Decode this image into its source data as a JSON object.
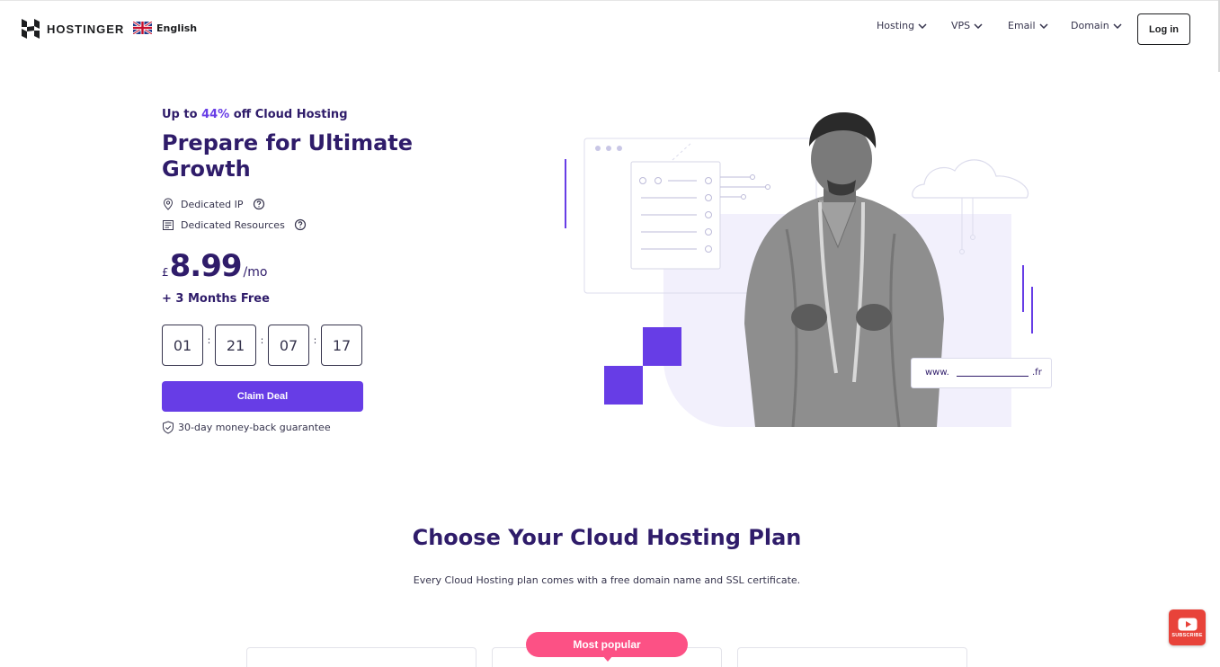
{
  "header": {
    "brand": "HOSTINGER",
    "language": "English",
    "nav": [
      {
        "label": "Hosting"
      },
      {
        "label": "VPS"
      },
      {
        "label": "Email"
      },
      {
        "label": "Domain"
      }
    ],
    "login_label": "Log in"
  },
  "hero": {
    "kicker_prefix": "Up to ",
    "kicker_percent": "44%",
    "kicker_suffix": " off Cloud Hosting",
    "title": "Prepare for Ultimate Growth",
    "features": [
      {
        "label": "Dedicated IP",
        "icon": "location-pin-icon"
      },
      {
        "label": "Dedicated Resources",
        "icon": "document-icon"
      }
    ],
    "price": {
      "currency": "£",
      "amount": "8.99",
      "period": "/mo"
    },
    "bonus": "+ 3 Months Free",
    "timer": [
      "01",
      "21",
      "07",
      "17"
    ],
    "timer_separator": ":",
    "cta_label": "Claim Deal",
    "guarantee": "30-day money-back guarantee"
  },
  "illustration": {
    "domain_prefix": "www.",
    "domain_suffix": ".fr"
  },
  "plans": {
    "title": "Choose Your Cloud Hosting Plan",
    "subtitle": "Every Cloud Hosting plan comes with a free domain name and SSL certificate.",
    "popular_badge": "Most popular"
  },
  "widget": {
    "subscribe_label": "SUBSCRIBE"
  },
  "colors": {
    "brand_purple": "#673de6",
    "heading": "#2f1c6a",
    "popular_pink": "#fc5185",
    "subscribe_red": "#e8433a"
  }
}
